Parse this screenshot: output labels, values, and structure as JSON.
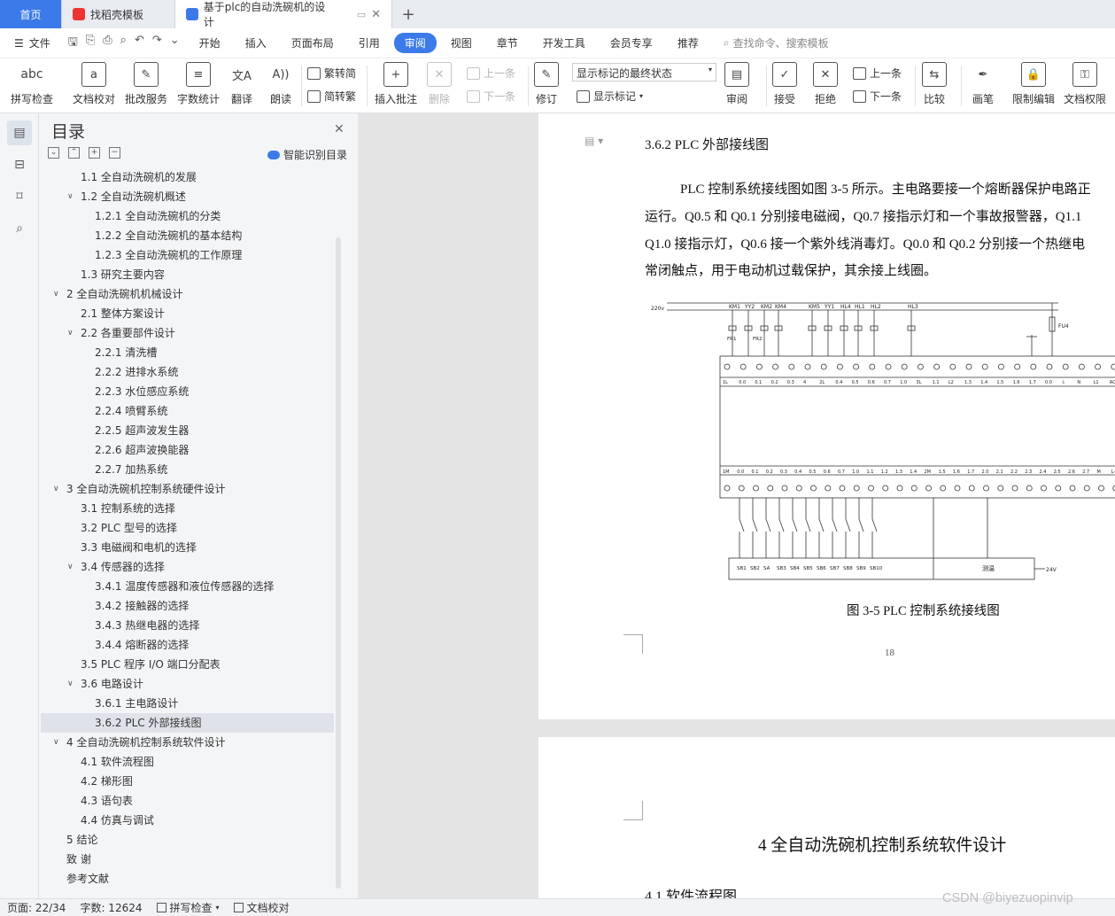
{
  "tabs": [
    {
      "label": "首页"
    },
    {
      "label": "找稻壳模板"
    },
    {
      "label": "基于plc的自动洗碗机的设计"
    }
  ],
  "menubar": {
    "file_label": "文件",
    "items": [
      "开始",
      "插入",
      "页面布局",
      "引用",
      "审阅",
      "视图",
      "章节",
      "开发工具",
      "会员专享",
      "推荐"
    ],
    "active": "审阅",
    "search_placeholder": "查找命令、搜索模板"
  },
  "ribbon": {
    "spell": "拼写检查",
    "proof": "文档校对",
    "batch": "批改服务",
    "wordcount": "字数统计",
    "translate": "翻译",
    "read": "朗读",
    "trad": "繁转简",
    "simp": "简转繁",
    "insert_comment": "插入批注",
    "delete": "删除",
    "prev": "上一条",
    "next": "下一条",
    "revise": "修订",
    "mark_state": "显示标记的最终状态",
    "show_marks": "显示标记",
    "review": "审阅",
    "accept": "接受",
    "reject": "拒绝",
    "prev2": "上一条",
    "next2": "下一条",
    "compare": "比较",
    "pen": "画笔",
    "restrict": "限制编辑",
    "rights": "文档权限"
  },
  "toc": {
    "title": "目录",
    "smart_label": "智能识别目录",
    "items": [
      {
        "text": "1.1 全自动洗碗机的发展",
        "level": 1
      },
      {
        "text": "1.2 全自动洗碗机概述",
        "level": 1
      },
      {
        "text": "1.2.1  全自动洗碗机的分类",
        "level": 2
      },
      {
        "text": "1.2.2  全自动洗碗机的基本结构",
        "level": 2
      },
      {
        "text": "1.2.3  全自动洗碗机的工作原理",
        "level": 2
      },
      {
        "text": "1.3 研究主要内容",
        "level": 1
      },
      {
        "text": "2  全自动洗碗机机械设计",
        "level": 0
      },
      {
        "text": "2.1  整体方案设计",
        "level": 1
      },
      {
        "text": "2.2  各重要部件设计",
        "level": 1
      },
      {
        "text": "2.2.1 清洗槽",
        "level": 2
      },
      {
        "text": "2.2.2 进排水系统",
        "level": 2
      },
      {
        "text": "2.2.3 水位感应系统",
        "level": 2
      },
      {
        "text": "2.2.4  喷臂系统",
        "level": 2
      },
      {
        "text": "2.2.5 超声波发生器",
        "level": 2
      },
      {
        "text": "2.2.6 超声波换能器",
        "level": 2
      },
      {
        "text": "2.2.7  加热系统",
        "level": 2
      },
      {
        "text": "3 全自动洗碗机控制系统硬件设计",
        "level": 0
      },
      {
        "text": "3.1 控制系统的选择",
        "level": 1
      },
      {
        "text": "3.2 PLC 型号的选择",
        "level": 1
      },
      {
        "text": "3.3 电磁阀和电机的选择",
        "level": 1
      },
      {
        "text": "3.4  传感器的选择",
        "level": 1
      },
      {
        "text": "3.4.1 温度传感器和液位传感器的选择",
        "level": 2
      },
      {
        "text": "3.4.2 接触器的选择",
        "level": 2
      },
      {
        "text": "3.4.3 热继电器的选择",
        "level": 2
      },
      {
        "text": "3.4.4 熔断器的选择",
        "level": 2
      },
      {
        "text": "3.5 PLC 程序 I/O 端口分配表",
        "level": 1
      },
      {
        "text": "3.6 电路设计",
        "level": 1
      },
      {
        "text": "3.6.1 主电路设计",
        "level": 2
      },
      {
        "text": "3.6.2 PLC 外部接线图",
        "level": 2
      },
      {
        "text": "4 全自动洗碗机控制系统软件设计",
        "level": 0
      },
      {
        "text": "4.1 软件流程图",
        "level": 1
      },
      {
        "text": "4.2 梯形图",
        "level": 1
      },
      {
        "text": "4.3 语句表",
        "level": 1
      },
      {
        "text": "4.4 仿真与调试",
        "level": 1
      },
      {
        "text": "5 结论",
        "level": 0
      },
      {
        "text": "致    谢",
        "level": 0
      },
      {
        "text": "参考文献",
        "level": 0
      }
    ],
    "expanded_indices": [
      1,
      6,
      8,
      16,
      20,
      26,
      29
    ],
    "selected_index": 28
  },
  "document": {
    "heading": "3.6.2 PLC 外部接线图",
    "paragraph": [
      "PLC 控制系统接线图如图 3-5 所示。主电路要接一个熔断器保护电路正",
      "运行。Q0.5 和 Q0.1 分别接电磁阀，Q0.7 接指示灯和一个事故报警器，Q1.1",
      "Q1.0 接指示灯，Q0.6 接一个紫外线消毒灯。Q0.0 和 Q0.2 分别接一个热继电",
      "常闭触点，用于电动机过载保护，其余接上线圈。"
    ],
    "caption": "图 3-5 PLC 控制系统接线图",
    "page_number": "18",
    "chapter4_title": "4 全自动洗碗机控制系统软件设计",
    "section41_title": "4.1 软件流程图"
  },
  "diagram": {
    "supply_label": "220v",
    "top_labels": [
      "KM1",
      "YY2",
      "KM2",
      "KM4",
      "KM5",
      "YY1",
      "HL4",
      "HL1",
      "HL2",
      "HL3"
    ],
    "fr_labels": [
      "FR1",
      "FR2"
    ],
    "fuse_label": "FU4",
    "out_terms": [
      "1L",
      "0.0",
      "0.1",
      "0.2",
      "0.3",
      "4",
      "2L",
      "0.4",
      "0.5",
      "0.6",
      "0.7",
      "1.0",
      "3L",
      "1.1",
      "L2",
      "1.3",
      "1.4",
      "1.5",
      "1.6",
      "1.7",
      "0.0",
      "⏚",
      "N",
      "L1",
      "AC"
    ],
    "in_terms": [
      "1M",
      "0.0",
      "0.1",
      "0.2",
      "0.3",
      "0.4",
      "0.5",
      "0.6",
      "0.7",
      "1.0",
      "1.1",
      "1.2",
      "1.3",
      "1.4",
      "2M",
      "1.5",
      "1.6",
      "1.7",
      "2.0",
      "2.1",
      "2.2",
      "2.3",
      "2.4",
      "2.5",
      "2.6",
      "2.7",
      "M",
      "L+"
    ],
    "switch_labels": [
      "SB1",
      "SB2",
      "SA",
      "SB3",
      "SB4",
      "SB5",
      "SB6",
      "SB7",
      "SB8",
      "SB9",
      "SB10"
    ],
    "temp_label": "测温",
    "dc_label": "24V"
  },
  "status": {
    "page": "页面: 22/34",
    "words": "字数: 12624",
    "spell": "拼写检查",
    "proof": "文档校对"
  },
  "watermark": "CSDN @biyezuopinvip",
  "colors": {
    "accent": "#3b7ae8",
    "panel": "#f4f5f7",
    "selected": "#dfe3e9"
  }
}
